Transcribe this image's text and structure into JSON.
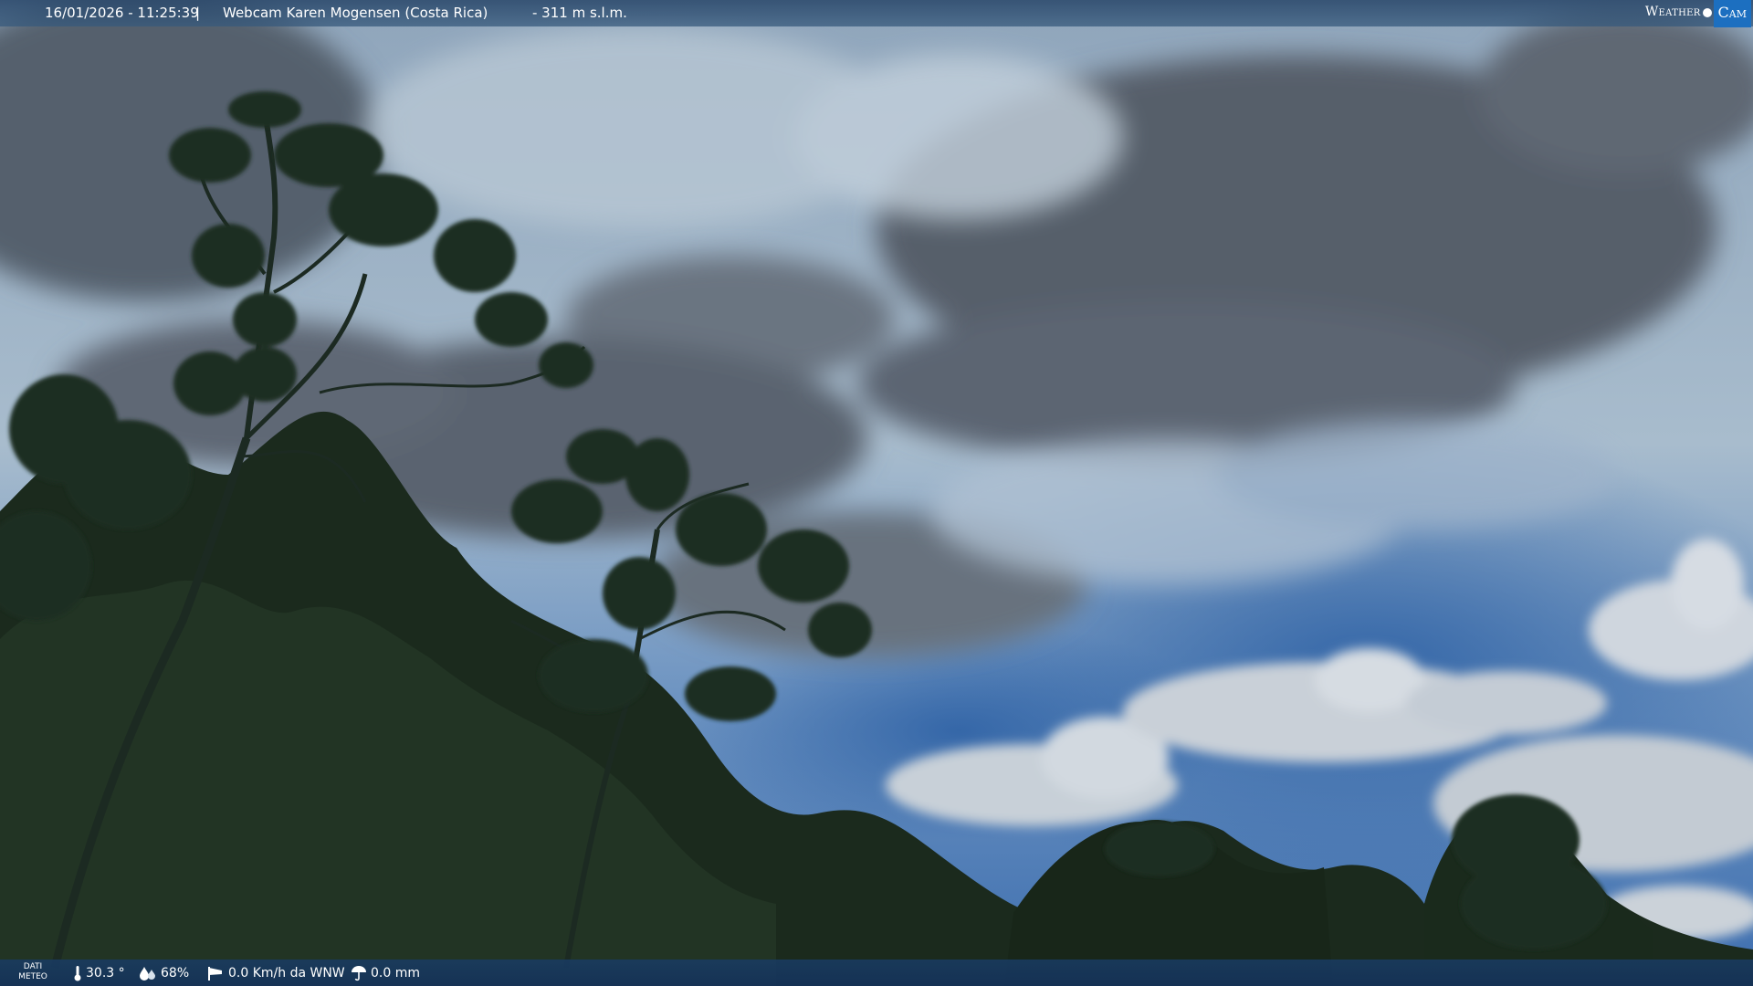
{
  "header": {
    "datetime": "16/01/2026 - 11:25:39",
    "separator": "|",
    "webcam_title": "Webcam Karen Mogensen (Costa Rica)",
    "altitude": "- 311 m s.l.m.",
    "logo_weather": "Weather",
    "logo_cam": "Cam"
  },
  "weather": {
    "label_line1": "DATI",
    "label_line2": "METEO",
    "temperature": "30.3 °",
    "humidity": "68%",
    "wind": "0.0 Km/h da WNW",
    "rain": "0.0 mm"
  },
  "icons": {
    "temperature": "thermometer-icon",
    "humidity": "drops-icon",
    "wind": "windsock-icon",
    "rain": "umbrella-icon"
  },
  "colors": {
    "sky_blue": "#3c6fae",
    "cloud_dark": "#4b5563",
    "foliage": "#1d2b1e",
    "bar": "#1f4a78"
  }
}
